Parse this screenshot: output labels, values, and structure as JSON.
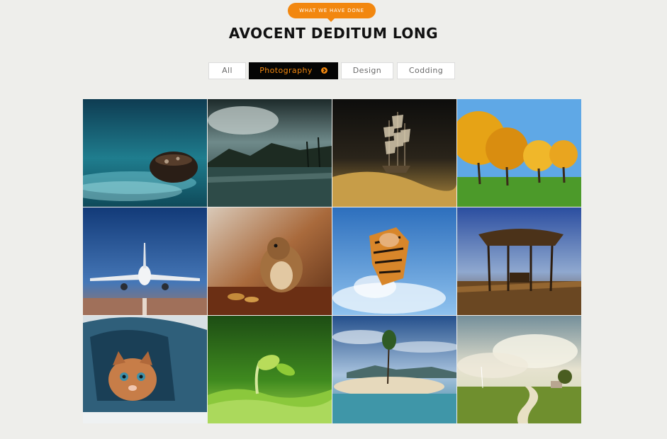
{
  "section": {
    "badge": "WHAT WE HAVE DONE",
    "title": "AVOCENT DEDITUM LONG"
  },
  "filters": {
    "all": "All",
    "photography": "Photography",
    "design": "Design",
    "codding": "Codding",
    "active": "Photography"
  },
  "colors": {
    "accent": "#f2870f",
    "active_tab_bg": "#050505",
    "page_bg": "#eeeeeb"
  },
  "gallery": [
    {
      "subject": "water-drop"
    },
    {
      "subject": "tropical-coast"
    },
    {
      "subject": "ship-in-desert"
    },
    {
      "subject": "autumn-trees"
    },
    {
      "subject": "airplane"
    },
    {
      "subject": "chipmunk"
    },
    {
      "subject": "tiger-in-water"
    },
    {
      "subject": "thatched-hut"
    },
    {
      "subject": "kitten-in-denim"
    },
    {
      "subject": "sprout"
    },
    {
      "subject": "tropical-island"
    },
    {
      "subject": "countryside-path"
    }
  ]
}
